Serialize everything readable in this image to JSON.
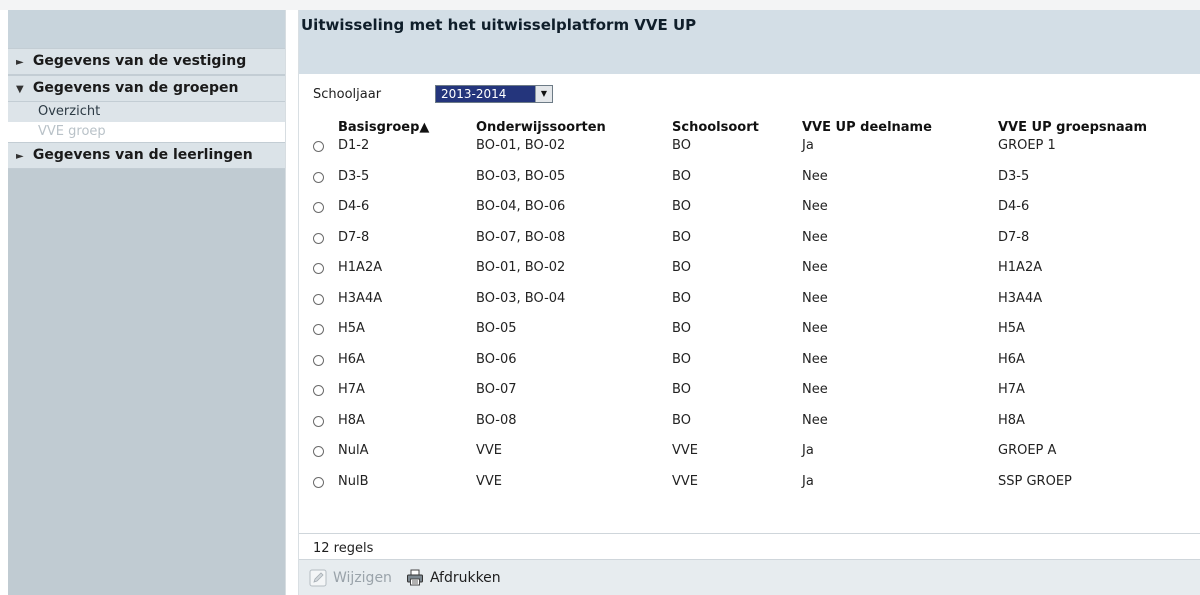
{
  "sidebar": {
    "sections": [
      {
        "label": "Gegevens van de vestiging",
        "expanded": false
      },
      {
        "label": "Gegevens van de groepen",
        "expanded": true
      },
      {
        "label": "Gegevens van de leerlingen",
        "expanded": false
      }
    ],
    "subitems": [
      {
        "label": "Overzicht"
      },
      {
        "label": "VVE groep"
      }
    ]
  },
  "main": {
    "title": "Uitwisseling met het uitwisselplatform VVE UP",
    "filter": {
      "label": "Schooljaar",
      "value": "2013-2014"
    },
    "columns": [
      "Basisgroep▲",
      "Onderwijssoorten",
      "Schoolsoort",
      "VVE UP deelname",
      "VVE UP groepsnaam"
    ],
    "rows": [
      [
        "D1-2",
        "BO-01, BO-02",
        "BO",
        "Ja",
        "GROEP 1"
      ],
      [
        "D3-5",
        "BO-03, BO-05",
        "BO",
        "Nee",
        "D3-5"
      ],
      [
        "D4-6",
        "BO-04, BO-06",
        "BO",
        "Nee",
        "D4-6"
      ],
      [
        "D7-8",
        "BO-07, BO-08",
        "BO",
        "Nee",
        "D7-8"
      ],
      [
        "H1A2A",
        "BO-01, BO-02",
        "BO",
        "Nee",
        "H1A2A"
      ],
      [
        "H3A4A",
        "BO-03, BO-04",
        "BO",
        "Nee",
        "H3A4A"
      ],
      [
        "H5A",
        "BO-05",
        "BO",
        "Nee",
        "H5A"
      ],
      [
        "H6A",
        "BO-06",
        "BO",
        "Nee",
        "H6A"
      ],
      [
        "H7A",
        "BO-07",
        "BO",
        "Nee",
        "H7A"
      ],
      [
        "H8A",
        "BO-08",
        "BO",
        "Nee",
        "H8A"
      ],
      [
        "NulA",
        "VVE",
        "VVE",
        "Ja",
        "GROEP A"
      ],
      [
        "NulB",
        "VVE",
        "VVE",
        "Ja",
        "SSP GROEP"
      ]
    ],
    "row_count_label": "12 regels"
  },
  "actions": {
    "edit_label": "Wijzigen",
    "edit_icon": "pencil-icon",
    "print_label": "Afdrukken",
    "print_icon": "printer-icon"
  },
  "colors": {
    "accent": "#24357c",
    "sidebar_bg": "#c0cbd2",
    "header_bg": "#d3dee6"
  }
}
